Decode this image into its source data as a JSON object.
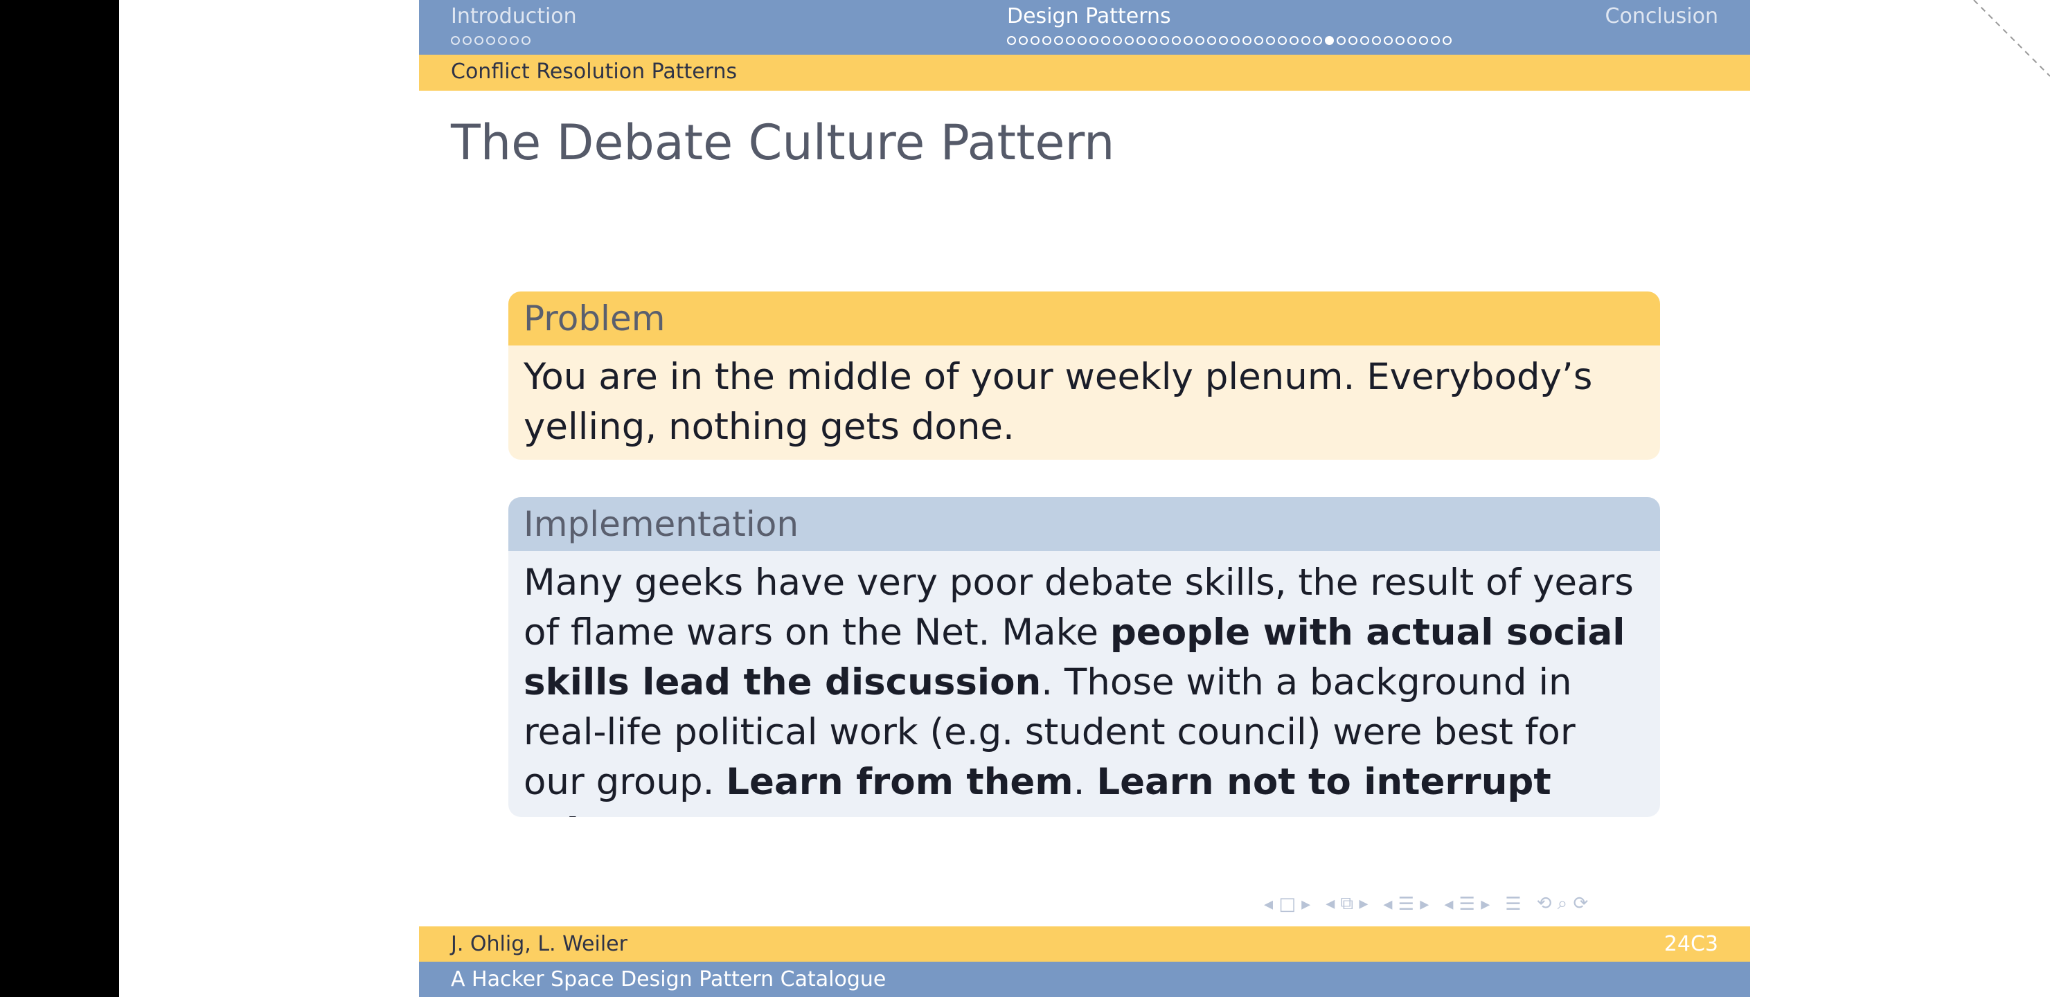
{
  "header": {
    "sections": [
      {
        "label": "Introduction",
        "dots": 7,
        "filled_index": -1,
        "active": false
      },
      {
        "label": "Design Patterns",
        "dots": 38,
        "filled_index": 27,
        "active": true
      },
      {
        "label": "Conclusion",
        "dots": 0,
        "filled_index": -1,
        "active": false
      }
    ],
    "subsection": "Conflict Resolution Patterns"
  },
  "slide": {
    "title": "The Debate Culture Pattern",
    "problem": {
      "heading": "Problem",
      "text": "You are in the middle of your weekly plenum. Everybody’s yelling, nothing gets done."
    },
    "implementation": {
      "heading": "Implementation",
      "t1": "Many geeks have very poor debate skills, the result of years of flame wars on the Net. Make ",
      "b1": "people with actual social skills lead the discussion",
      "t2": ". Those with a background in real-life political work (e.g. student council) were best for our group. ",
      "b2": "Learn from them",
      "t3": ". ",
      "b3": "Learn not to interrupt others",
      "t4": "."
    }
  },
  "nav_symbols": [
    "◂ □ ▸",
    "◂ ⧉ ▸",
    "◂ ☰ ▸",
    "◂ ☰ ▸",
    "☰",
    "⟲ ⌕ ⟳"
  ],
  "footer": {
    "authors": "J. Ohlig, L. Weiler",
    "event": "24C3",
    "title": "A Hacker Space Design Pattern Catalogue"
  },
  "colors": {
    "nav_blue": "#7898c4",
    "accent_yellow": "#fccf62",
    "problem_body": "#fef2db",
    "impl_head": "#c0d0e3",
    "impl_body": "#edf1f7"
  }
}
